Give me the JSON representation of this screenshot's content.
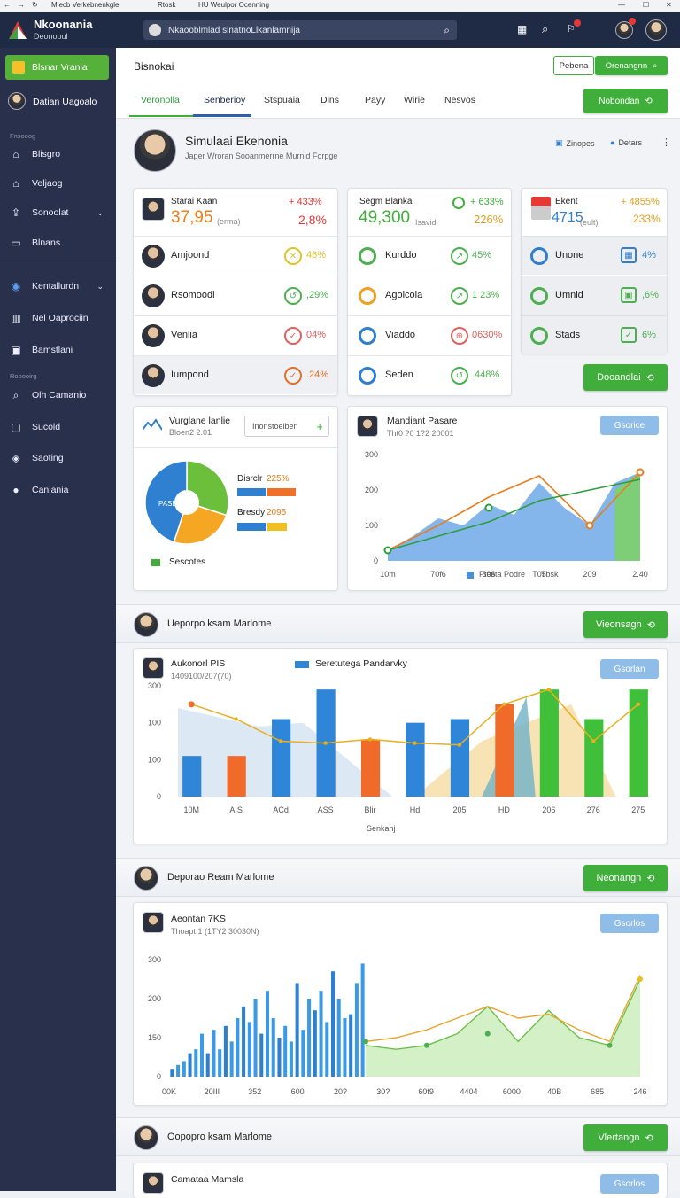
{
  "browser": {
    "tab1": "Mlecb Verkebnenkgle",
    "tab2": "Rtosk",
    "tab3": "HU  Weulpor Ocenning"
  },
  "app": {
    "name": "Nkoonania",
    "sub": "Deonopul"
  },
  "search": {
    "value": "Nkaooblmlad slnatnoLlkanlamnija"
  },
  "sidebar": {
    "primary": "Blsnar Vrania",
    "user": "Datian Uagoalo",
    "section1": "Fnsooog",
    "items1": [
      {
        "label": "Blisgro",
        "icon": "home-icon"
      },
      {
        "label": "Veljaog",
        "icon": "home-icon"
      },
      {
        "label": "Sonoolat",
        "icon": "user-upload-icon"
      },
      {
        "label": "Blnans",
        "icon": "card-icon"
      }
    ],
    "items2": [
      {
        "label": "Kentallurdn",
        "icon": "globe-icon"
      },
      {
        "label": "Nel Oaprociin",
        "icon": "grid-icon"
      },
      {
        "label": "Bamstlani",
        "icon": "doc-icon"
      }
    ],
    "section2": "Rooooirg",
    "items3": [
      {
        "label": "Olh Camanio",
        "icon": "search-icon"
      },
      {
        "label": "Sucold",
        "icon": "doc-icon"
      },
      {
        "label": "Saoting",
        "icon": "layers-icon"
      },
      {
        "label": "Canlania",
        "icon": "avatar-icon"
      }
    ]
  },
  "header": {
    "title": "Bisnokai",
    "btn_outline": "Pebena",
    "btn_search": "Orenangnn",
    "tabs": [
      "Veronolla",
      "Senberioy",
      "Stspuaia",
      "Dins",
      "Payy",
      "Wirie",
      "Nesvos"
    ],
    "active_tab": 1,
    "tab_action": "Nobondan"
  },
  "profile": {
    "name": "Simulaai Ekenonia",
    "subtitle": "Japer Wroran Sooanmerrne Murnid Forpge",
    "link1": "Zinopes",
    "link2": "Detars"
  },
  "stats": {
    "col1": {
      "head_label": "Starai Kaan",
      "head_value": "37,95",
      "head_unit": "(erma)",
      "head_change": "+ 433%",
      "head_pct": "2,8%",
      "rows": [
        {
          "label": "Amjoond",
          "pct": "46%",
          "color": "#e0c32a",
          "glyph": "✕"
        },
        {
          "label": "Rsomoodi",
          "pct": ",29%",
          "color": "#4caf50",
          "glyph": "↺"
        },
        {
          "label": "Venlia",
          "pct": "04%",
          "color": "#e0605a",
          "glyph": "✓"
        },
        {
          "label": "Iumpond",
          "pct": ".24%",
          "color": "#e0702a",
          "glyph": "✓"
        }
      ]
    },
    "col2": {
      "head_label": "Segm Blanka",
      "head_value": "49,300",
      "head_unit": "Isavid",
      "head_change": "+ 633%",
      "head_pct": "226%",
      "rows": [
        {
          "label": "Kurddo",
          "pct": "45%",
          "color": "#4caf50",
          "glyph": "↗",
          "icon": "#4caf50"
        },
        {
          "label": "Agolcola",
          "pct": "1 23%",
          "color": "#4caf50",
          "glyph": "↗",
          "icon": "#f0a020"
        },
        {
          "label": "Viaddo",
          "pct": "0630%",
          "color": "#e0605a",
          "glyph": "⊕",
          "icon": "#2f7fd0"
        },
        {
          "label": "Seden",
          "pct": ".448%",
          "color": "#4caf50",
          "glyph": "↺",
          "icon": "#2f7fd0"
        }
      ]
    },
    "col3": {
      "head_label": "Ekent",
      "head_value": "4715",
      "head_unit": "(eult)",
      "head_change": "+ 4855%",
      "head_pct": "233%",
      "rows": [
        {
          "label": "Unone",
          "pct": "4%",
          "color": "#2f7fd0",
          "glyph": "▦",
          "icon": "#2f7fd0"
        },
        {
          "label": "Umnld",
          "pct": ",6%",
          "color": "#4caf50",
          "glyph": "▣",
          "icon": "#4caf50"
        },
        {
          "label": "Stads",
          "pct": "6%",
          "color": "#4caf50",
          "glyph": "✓",
          "icon": "#4caf50"
        }
      ],
      "action": "Dooandlai"
    }
  },
  "pie_card": {
    "title": "Vurglane lanlie",
    "subtitle": "Bloen2 2.01",
    "btn": "Inonstoelben",
    "center_label": "PASEA",
    "legend1": "Disrclr",
    "legend1_val": "225%",
    "legend2": "Bresdy",
    "legend2_val": "2095",
    "footer": "Sescotes"
  },
  "line_card": {
    "title": "Mandiant Pasare",
    "subtitle": "Tht0 ?0 1?2 20001",
    "btn": "Gsorice",
    "legend1": "Ptesta Podre",
    "legend2": "Tbsk"
  },
  "section2": {
    "title": "Ueporpo ksam Marlome",
    "btn": "Vieonsagn"
  },
  "bar_card": {
    "title": "Aukonorl PIS",
    "subtitle": "1409100/207(70)",
    "legend": "Seretutega Pandarvky",
    "btn": "Gsorlan",
    "xlabel": "Senkanj"
  },
  "section3": {
    "title": "Deporao Ream Marlome",
    "btn": "Neonangn"
  },
  "hist_card": {
    "title": "Aeontan 7KS",
    "subtitle": "Thoapt 1 (1TY2 30030N)",
    "btn": "Gsorlos"
  },
  "section4": {
    "title": "Oopopro ksam Marlome",
    "btn": "Vlertangn"
  },
  "bottom_card": {
    "title": "Camataa Mamsla",
    "btn": "Gsorlos"
  },
  "colors": {
    "green": "#3fae3b",
    "blue": "#2f7fd0",
    "orange": "#f0702a",
    "yellow": "#e8c020",
    "sidebar": "#28304b"
  },
  "chart_data": [
    {
      "type": "pie",
      "values": [
        {
          "label": "Disrclr",
          "value": 30,
          "color": "#6cbf3a"
        },
        {
          "label": "Bresdy",
          "value": 25,
          "color": "#f5a623"
        },
        {
          "label": "PASEA",
          "value": 45,
          "color": "#2f80d0"
        }
      ]
    },
    {
      "type": "area",
      "title": "Mandiant Pasare",
      "x_ticks": [
        "10m",
        "70f6",
        "306",
        "T05",
        "209",
        "2.40"
      ],
      "y_ticks": [
        "300",
        "200",
        "100",
        "0"
      ],
      "ylim": [
        0,
        300
      ],
      "series": [
        {
          "name": "Ptesta Podre",
          "color": "#4a90d9",
          "values": [
            30,
            70,
            120,
            100,
            160,
            130,
            220,
            150,
            100,
            220,
            250
          ]
        },
        {
          "color": "#e67e22",
          "values": [
            30,
            80,
            100,
            140,
            180,
            200,
            240,
            160,
            100,
            180,
            250
          ]
        },
        {
          "color": "#2e9d3f",
          "values": [
            30,
            70,
            110,
            170,
            200,
            230
          ]
        }
      ]
    },
    {
      "type": "bar",
      "title": "Aukonorl PIS",
      "categories": [
        "10M",
        "AIS",
        "ACd",
        "ASS",
        "Blir",
        "Hd",
        "205",
        "HD",
        "206",
        "276",
        "275"
      ],
      "y_ticks": [
        "300",
        "100",
        "100",
        "0"
      ],
      "ylim": [
        0,
        300
      ],
      "series": [
        {
          "name": "Seretutega Pandarvky",
          "color": "#2f86d8",
          "values": [
            110,
            0,
            210,
            290,
            0,
            200,
            210,
            0,
            0,
            0,
            0
          ]
        },
        {
          "color": "#f06a2a",
          "values": [
            0,
            110,
            0,
            0,
            155,
            0,
            0,
            250,
            0,
            0,
            210
          ]
        },
        {
          "color": "#3fbf3a",
          "values": [
            0,
            0,
            0,
            0,
            0,
            0,
            0,
            0,
            290,
            210,
            290
          ]
        }
      ],
      "line": [
        250,
        210,
        150,
        145,
        155,
        145,
        140,
        250,
        290,
        150,
        250
      ]
    },
    {
      "type": "bar",
      "title": "Aeontan 7KS",
      "x_ticks": [
        "00K",
        "20III",
        "352",
        "600",
        "20?",
        "30?",
        "60f9",
        "4404",
        "6000",
        "40B",
        "685",
        "246"
      ],
      "y_ticks": [
        "300",
        "200",
        "150",
        "0"
      ],
      "ylim": [
        0,
        300
      ],
      "values": [
        20,
        30,
        40,
        60,
        70,
        110,
        60,
        120,
        70,
        130,
        90,
        150,
        180,
        140,
        200,
        110,
        220,
        150,
        100,
        130,
        90,
        240,
        120,
        200,
        170,
        220,
        140,
        270,
        200,
        150,
        160,
        240,
        290
      ],
      "area": [
        80,
        70,
        80,
        110,
        180,
        90,
        170,
        100,
        80,
        250
      ],
      "line": [
        90,
        100,
        120,
        150,
        180,
        150,
        160,
        120,
        90,
        260
      ]
    }
  ]
}
